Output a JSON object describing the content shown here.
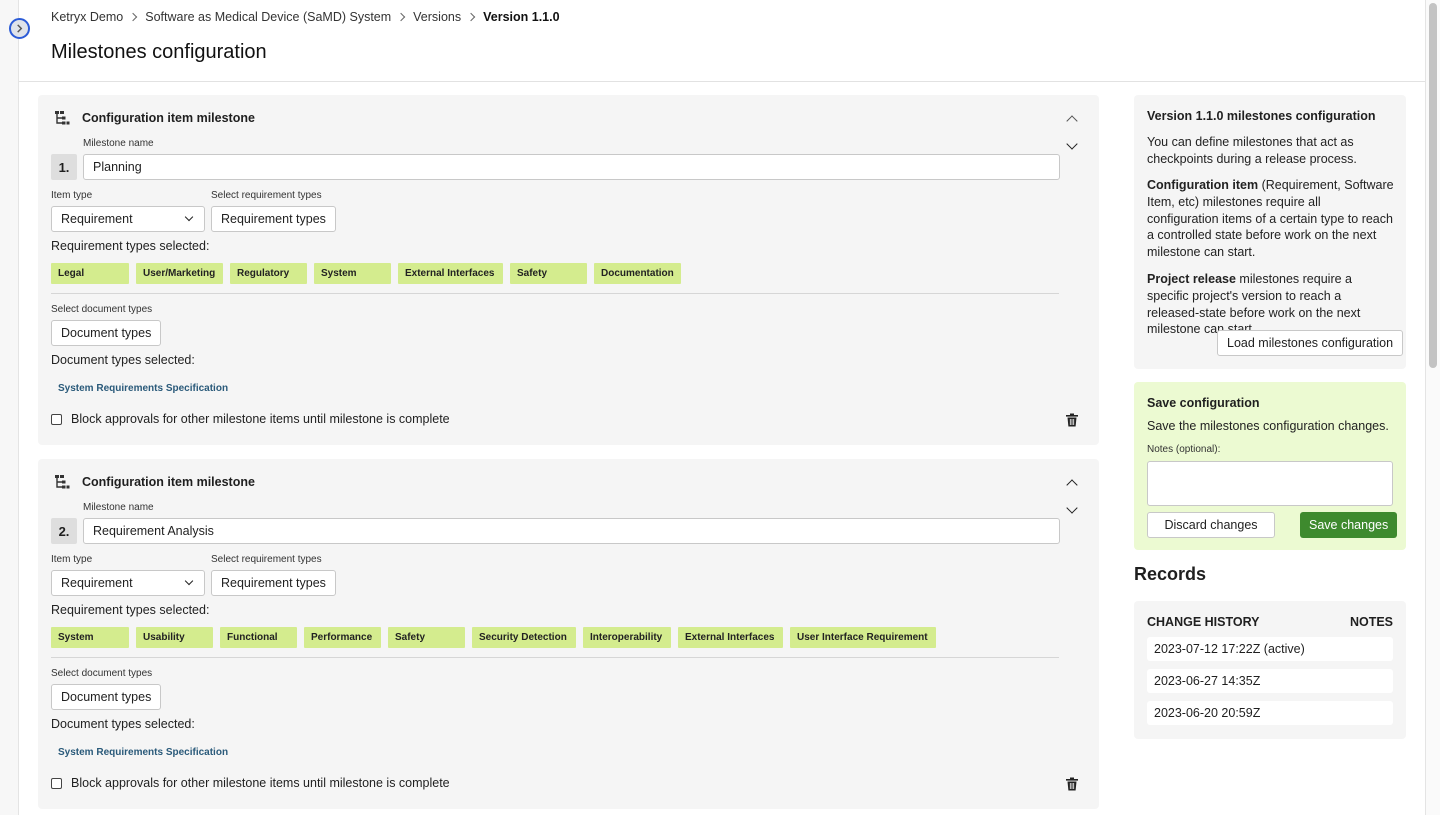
{
  "breadcrumb": [
    {
      "label": "Ketryx Demo"
    },
    {
      "label": "Software as Medical Device (SaMD) System"
    },
    {
      "label": "Versions"
    },
    {
      "label": "Version 1.1.0"
    }
  ],
  "page_title": "Milestones configuration",
  "milestones": [
    {
      "header": "Configuration item milestone",
      "number": "1.",
      "milestone_name_label": "Milestone name",
      "milestone_name": "Planning",
      "item_type_label": "Item type",
      "item_type": "Requirement",
      "select_req_types_label": "Select requirement types",
      "req_types_button": "Requirement types",
      "req_selected_label": "Requirement types selected:",
      "req_tags": [
        "Legal",
        "User/Marketing",
        "Regulatory",
        "System",
        "External Interfaces",
        "Safety",
        "Documentation"
      ],
      "select_doc_types_label": "Select document types",
      "doc_types_button": "Document types",
      "doc_selected_label": "Document types selected:",
      "doc_tags": [
        "System Requirements Specification"
      ],
      "block_label": "Block approvals for other milestone items until milestone is complete"
    },
    {
      "header": "Configuration item milestone",
      "number": "2.",
      "milestone_name_label": "Milestone name",
      "milestone_name": "Requirement Analysis",
      "item_type_label": "Item type",
      "item_type": "Requirement",
      "select_req_types_label": "Select requirement types",
      "req_types_button": "Requirement types",
      "req_selected_label": "Requirement types selected:",
      "req_tags": [
        "System",
        "Usability",
        "Functional",
        "Performance",
        "Safety",
        "Security Detection",
        "Interoperability",
        "External Interfaces",
        "User Interface Requirement"
      ],
      "select_doc_types_label": "Select document types",
      "doc_types_button": "Document types",
      "doc_selected_label": "Document types selected:",
      "doc_tags": [
        "System Requirements Specification"
      ],
      "block_label": "Block approvals for other milestone items until milestone is complete"
    }
  ],
  "info": {
    "title": "Version 1.1.0 milestones configuration",
    "intro": "You can define milestones that act as checkpoints during a release process.",
    "ci_bold": "Configuration item",
    "ci_text": " (Requirement, Software Item, etc) milestones require all configuration items of a certain type to reach a controlled state before work on the next milestone can start.",
    "pr_bold": "Project release",
    "pr_text": " milestones require a specific project's version to reach a released-state before work on the next milestone can start.",
    "load_button": "Load milestones configuration"
  },
  "save": {
    "title": "Save configuration",
    "desc": "Save the milestones configuration changes.",
    "notes_label": "Notes (optional):",
    "notes_value": "",
    "discard_button": "Discard changes",
    "save_button": "Save changes"
  },
  "records": {
    "title": "Records",
    "change_history_header": "CHANGE HISTORY",
    "notes_header": "NOTES",
    "entries": [
      "2023-07-12 17:22Z (active)",
      "2023-06-27 14:35Z",
      "2023-06-20 20:59Z"
    ]
  },
  "colors": {
    "tag_bg": "#d4ec8e",
    "save_green": "#3e8a2e",
    "save_panel_bg": "#ecfad2",
    "link_blue": "#2b5bd7"
  }
}
